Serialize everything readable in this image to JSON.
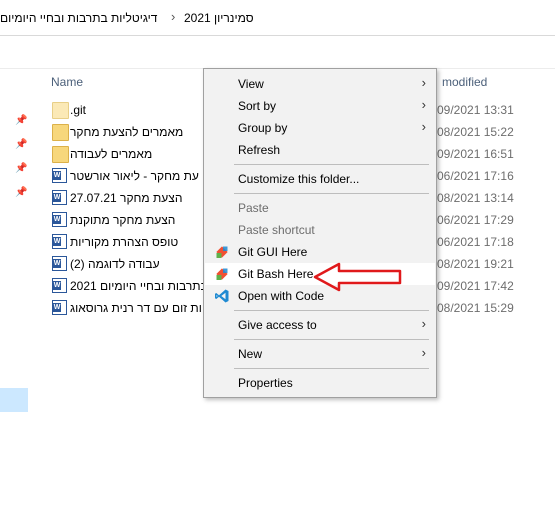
{
  "address_bar": {
    "crumbs": [
      "סמינריון 2021",
      "דיגיטליות בתרבות ובחיי היומיום"
    ],
    "separator": "›"
  },
  "columns": {
    "name": "Name",
    "modified": "modified"
  },
  "files": [
    {
      "name": ".git",
      "modified": "09/2021 13:31",
      "icon": "folder-icon"
    },
    {
      "name": "מאמרים להצעת מחקר",
      "modified": "08/2021 15:22",
      "icon": "folder-icon"
    },
    {
      "name": "מאמרים לעבודה",
      "modified": "09/2021 16:51",
      "icon": "folder-icon"
    },
    {
      "name": "עת מחקר - ליאור אורשטר",
      "modified": "06/2021 17:16",
      "icon": "word-icon"
    },
    {
      "name": "27.07.21 הצעת מחקר",
      "modified": "08/2021 13:14",
      "icon": "word-icon"
    },
    {
      "name": "הצעת מחקר מתוקנת",
      "modified": "06/2021 17:29",
      "icon": "word-icon"
    },
    {
      "name": "טופס הצהרת מקוריות",
      "modified": "06/2021 17:18",
      "icon": "word-icon"
    },
    {
      "name": "(2) עבודה לדוגמה",
      "modified": "08/2021 19:21",
      "icon": "word-icon"
    },
    {
      "name": "2021 בתרבות ובחיי היומיום",
      "modified": "09/2021 17:42",
      "icon": "word-icon"
    },
    {
      "name": "ות זום עם דר רנית גרוסאוג",
      "modified": "08/2021 15:29",
      "icon": "word-icon"
    }
  ],
  "context_menu": {
    "view": "View",
    "sort_by": "Sort by",
    "group_by": "Group by",
    "refresh": "Refresh",
    "customize": "Customize this folder...",
    "paste": "Paste",
    "paste_shortcut": "Paste shortcut",
    "git_gui": "Git GUI Here",
    "git_bash": "Git Bash Here",
    "open_with_code": "Open with Code",
    "give_access": "Give access to",
    "new": "New",
    "properties": "Properties",
    "submenu_arrow": "›"
  },
  "colors": {
    "annotation_arrow": "#e0191b",
    "git_orange": "#f05033",
    "git_green": "#5fb04a",
    "vscode_blue": "#1f8ad2",
    "column_header": "#4c607a",
    "selection": "#cce8ff"
  }
}
